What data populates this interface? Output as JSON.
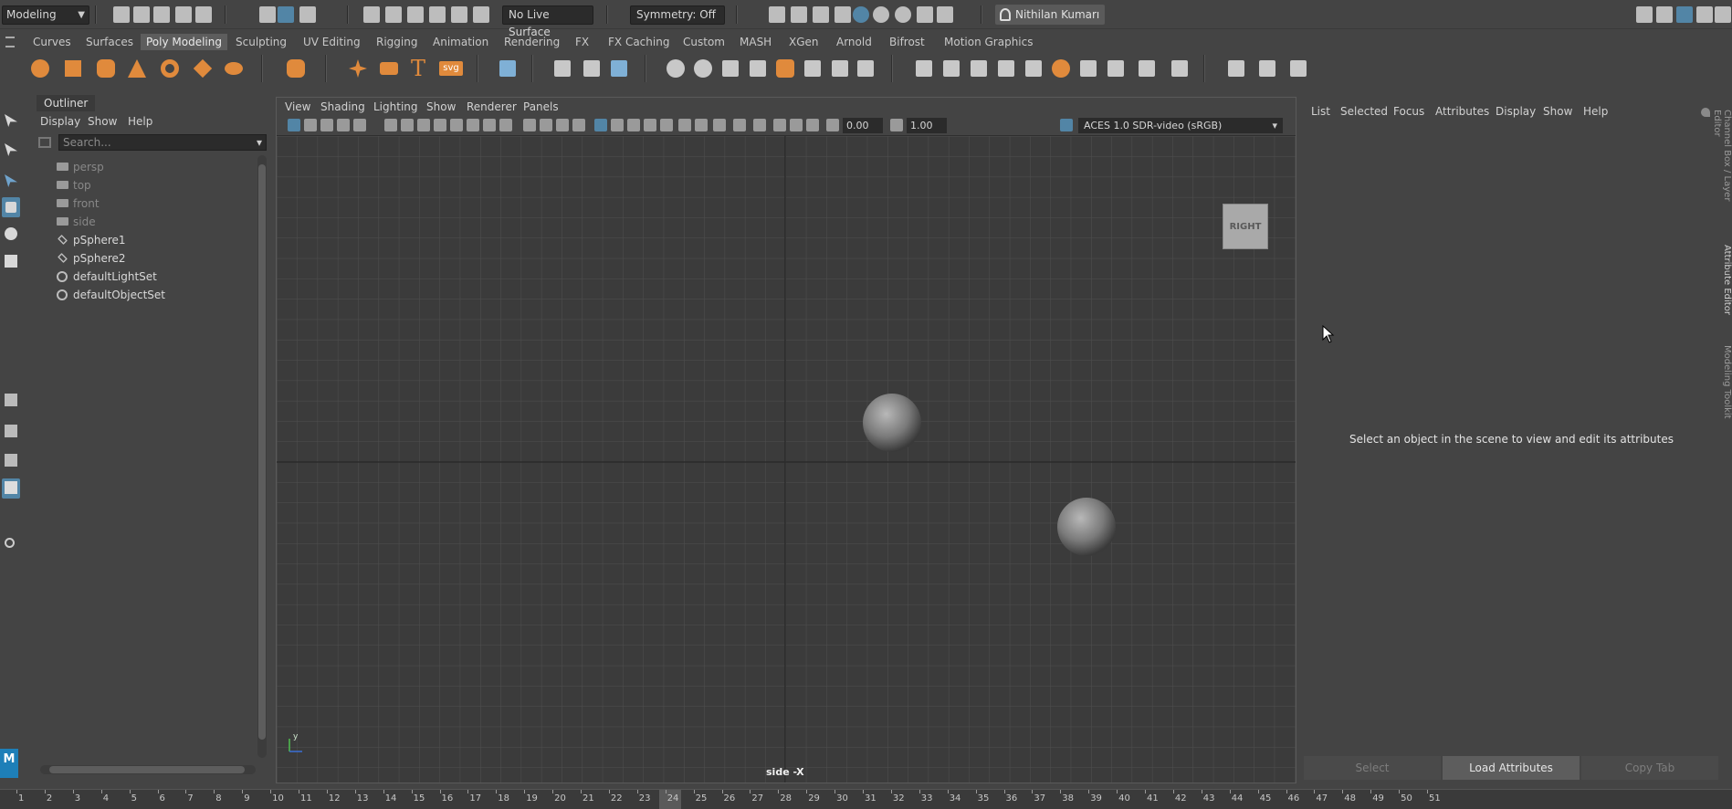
{
  "statusline": {
    "mode": "Modeling",
    "live_surface": "No Live Surface",
    "symmetry": "Symmetry: Off",
    "user": "Nithilan Kumarı"
  },
  "shelf_tabs": [
    "Curves",
    "Surfaces",
    "Poly Modeling",
    "Sculpting",
    "UV Editing",
    "Rigging",
    "Animation",
    "Rendering",
    "FX",
    "FX Caching",
    "Custom",
    "MASH",
    "XGen",
    "Arnold",
    "Bifrost",
    "Motion Graphics"
  ],
  "shelf_active": "Poly Modeling",
  "shelf_icons": [
    "poly-sphere-icon",
    "poly-cube-icon",
    "poly-cylinder-icon",
    "poly-cone-icon",
    "poly-torus-icon",
    "poly-plane-icon",
    "poly-disc-icon",
    "platonic-solid-icon",
    "super-shape-icon",
    "sweep-mesh-icon",
    "type-tool-icon",
    "svg-tool-icon",
    "seed-grid-icon",
    "combine-icon",
    "separate-icon",
    "mirror-icon",
    "smooth-icon",
    "boolean-icon",
    "extract-icon",
    "bridge-icon",
    "extrude-icon",
    "bevel-icon",
    "fill-hole-icon",
    "multi-cut-icon",
    "target-weld-icon",
    "connect-icon",
    "bridge-edge-icon",
    "duplicate-face-icon",
    "merge-icon",
    "collapse-icon",
    "edit-edge-flow-icon",
    "quad-draw-icon",
    "slide-edge-icon"
  ],
  "outliner": {
    "title": "Outliner",
    "menus": [
      "Display",
      "Show",
      "Help"
    ],
    "search_placeholder": "Search...",
    "items": [
      {
        "label": "persp",
        "type": "camera",
        "dim": true
      },
      {
        "label": "top",
        "type": "camera",
        "dim": true
      },
      {
        "label": "front",
        "type": "camera",
        "dim": true
      },
      {
        "label": "side",
        "type": "camera",
        "dim": true
      },
      {
        "label": "pSphere1",
        "type": "mesh",
        "dim": false
      },
      {
        "label": "pSphere2",
        "type": "mesh",
        "dim": false
      },
      {
        "label": "defaultLightSet",
        "type": "set",
        "dim": false
      },
      {
        "label": "defaultObjectSet",
        "type": "set",
        "dim": false
      }
    ]
  },
  "viewport": {
    "menus": [
      "View",
      "Shading",
      "Lighting",
      "Show",
      "Renderer",
      "Panels"
    ],
    "exposure": "0.00",
    "gamma": "1.00",
    "color_space": "ACES 1.0 SDR-video (sRGB)",
    "viewcube_label": "RIGHT",
    "camera_label": "side -X",
    "axis_label": "y"
  },
  "attribute_editor": {
    "menus": [
      "List",
      "Selected",
      "Focus",
      "Attributes",
      "Display",
      "Show",
      "Help"
    ],
    "message": "Select an object in the scene to view and edit its attributes",
    "buttons": [
      "Select",
      "Load Attributes",
      "Copy Tab"
    ]
  },
  "side_tabs": [
    "Channel Box / Layer Editor",
    "Attribute Editor",
    "Modeling Toolkit"
  ],
  "timeline": {
    "frames": [
      "1",
      "2",
      "3",
      "4",
      "5",
      "6",
      "7",
      "8",
      "9",
      "10",
      "11",
      "12",
      "13",
      "14",
      "15",
      "16",
      "17",
      "18",
      "19",
      "20",
      "21",
      "22",
      "23",
      "24",
      "25",
      "26",
      "27",
      "28",
      "29",
      "30",
      "31",
      "32",
      "33",
      "34",
      "35",
      "36",
      "37",
      "38",
      "39",
      "40",
      "41",
      "42",
      "43",
      "44",
      "45",
      "46",
      "47",
      "48",
      "49",
      "50",
      "51"
    ],
    "current_frame": "24"
  },
  "colors": {
    "accent_blue": "#5285a6",
    "shelf_orange": "#e08a3c",
    "panel_bg": "#444444",
    "viewport_bg": "#3b3b3b"
  }
}
